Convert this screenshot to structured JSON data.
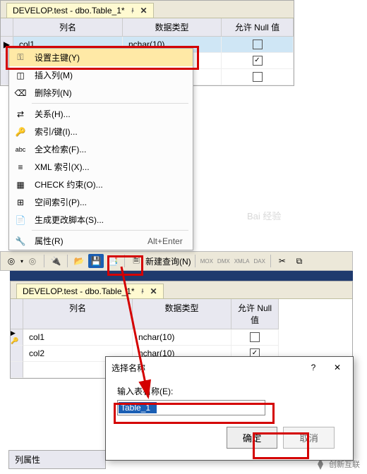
{
  "top_tab": {
    "title": "DEVELOP.test - dbo.Table_1*"
  },
  "grid_headers": {
    "col_name": "列名",
    "data_type": "数据类型",
    "allow_null": "允许 Null 值"
  },
  "top_rows": [
    {
      "name": "col1",
      "type": "nchar(10)",
      "null": false,
      "active": true
    }
  ],
  "context_menu": {
    "items": [
      {
        "label": "设置主键(Y)",
        "icon": "key-icon",
        "highlight": true
      },
      {
        "label": "插入列(M)",
        "icon": "insert-col-icon"
      },
      {
        "label": "删除列(N)",
        "icon": "delete-col-icon"
      },
      {
        "label": "关系(H)...",
        "icon": "relationship-icon"
      },
      {
        "label": "索引/键(I)...",
        "icon": "index-icon"
      },
      {
        "label": "全文检索(F)...",
        "icon": "fulltext-icon"
      },
      {
        "label": "XML 索引(X)...",
        "icon": "xml-index-icon"
      },
      {
        "label": "CHECK 约束(O)...",
        "icon": "check-constraint-icon"
      },
      {
        "label": "空间索引(P)...",
        "icon": "spatial-index-icon"
      },
      {
        "label": "生成更改脚本(S)...",
        "icon": "gen-script-icon"
      },
      {
        "label": "属性(R)",
        "icon": "wrench-icon",
        "shortcut": "Alt+Enter"
      }
    ]
  },
  "toolbar": {
    "new_query": "新建查询(N)",
    "small_btns": [
      "MOX",
      "DMX",
      "XMLA",
      "DAX"
    ]
  },
  "bottom_tab": {
    "title": "DEVELOP.test - dbo.Table_1*"
  },
  "bottom_rows": [
    {
      "name": "col1",
      "type": "nchar(10)",
      "null": false,
      "active": true,
      "key": true
    },
    {
      "name": "col2",
      "type": "nchar(10)",
      "null": true
    }
  ],
  "dialog": {
    "title": "选择名称",
    "label": "输入表名称(E):",
    "value": "Table_1",
    "ok": "确定",
    "cancel": "取消"
  },
  "side_panel": "列属性",
  "watermark": "创新互联",
  "baidu_wm": "Bai 经验"
}
